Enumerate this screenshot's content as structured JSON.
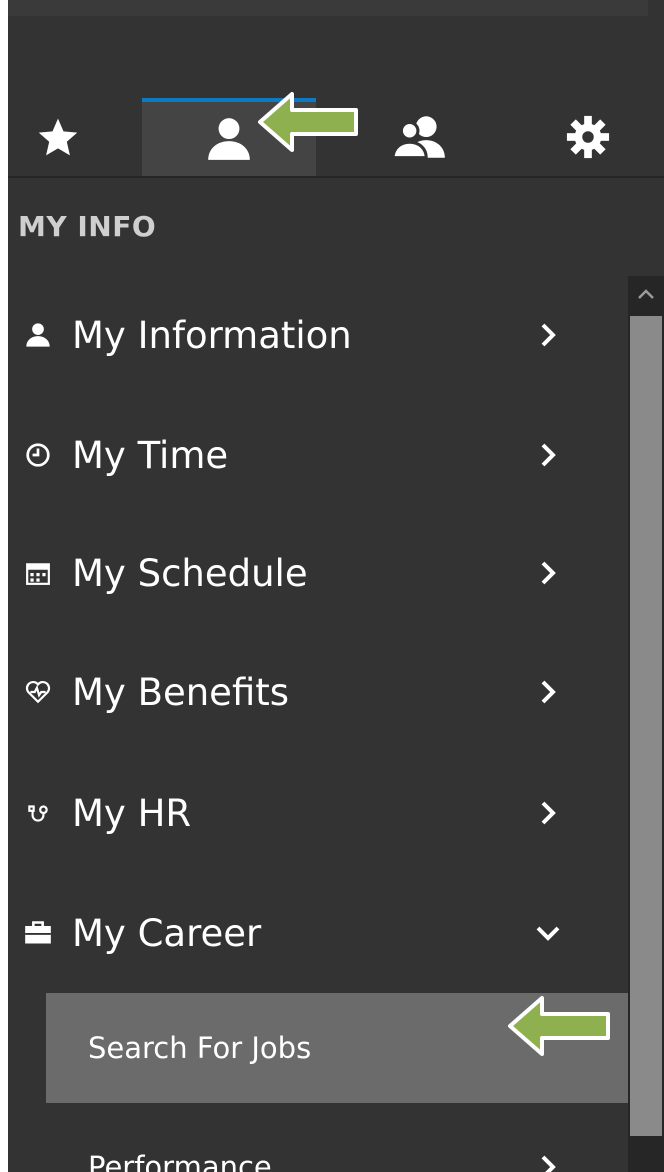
{
  "tabs": [
    {
      "icon": "star-icon",
      "active": false
    },
    {
      "icon": "user-icon",
      "active": true
    },
    {
      "icon": "users-icon",
      "active": false
    },
    {
      "icon": "gear-icon",
      "active": false
    }
  ],
  "section": {
    "label": "MY INFO"
  },
  "menu": [
    {
      "label": "My Information",
      "icon": "user-icon",
      "state": "collapsed"
    },
    {
      "label": "My Time",
      "icon": "clock-icon",
      "state": "collapsed"
    },
    {
      "label": "My Schedule",
      "icon": "calendar-icon",
      "state": "collapsed"
    },
    {
      "label": "My Benefits",
      "icon": "heartbeat-icon",
      "state": "collapsed"
    },
    {
      "label": "My HR",
      "icon": "hr-icon",
      "state": "collapsed"
    },
    {
      "label": "My Career",
      "icon": "briefcase-icon",
      "state": "expanded"
    }
  ],
  "submenu": [
    {
      "label": "Search For Jobs",
      "selected": true
    },
    {
      "label": "Performance",
      "selected": false
    }
  ],
  "colors": {
    "background": "#333333",
    "active_tab_accent": "#0e7ac4",
    "selected_row": "#6b6b6b",
    "annotation_arrow": "#8fb04f"
  }
}
